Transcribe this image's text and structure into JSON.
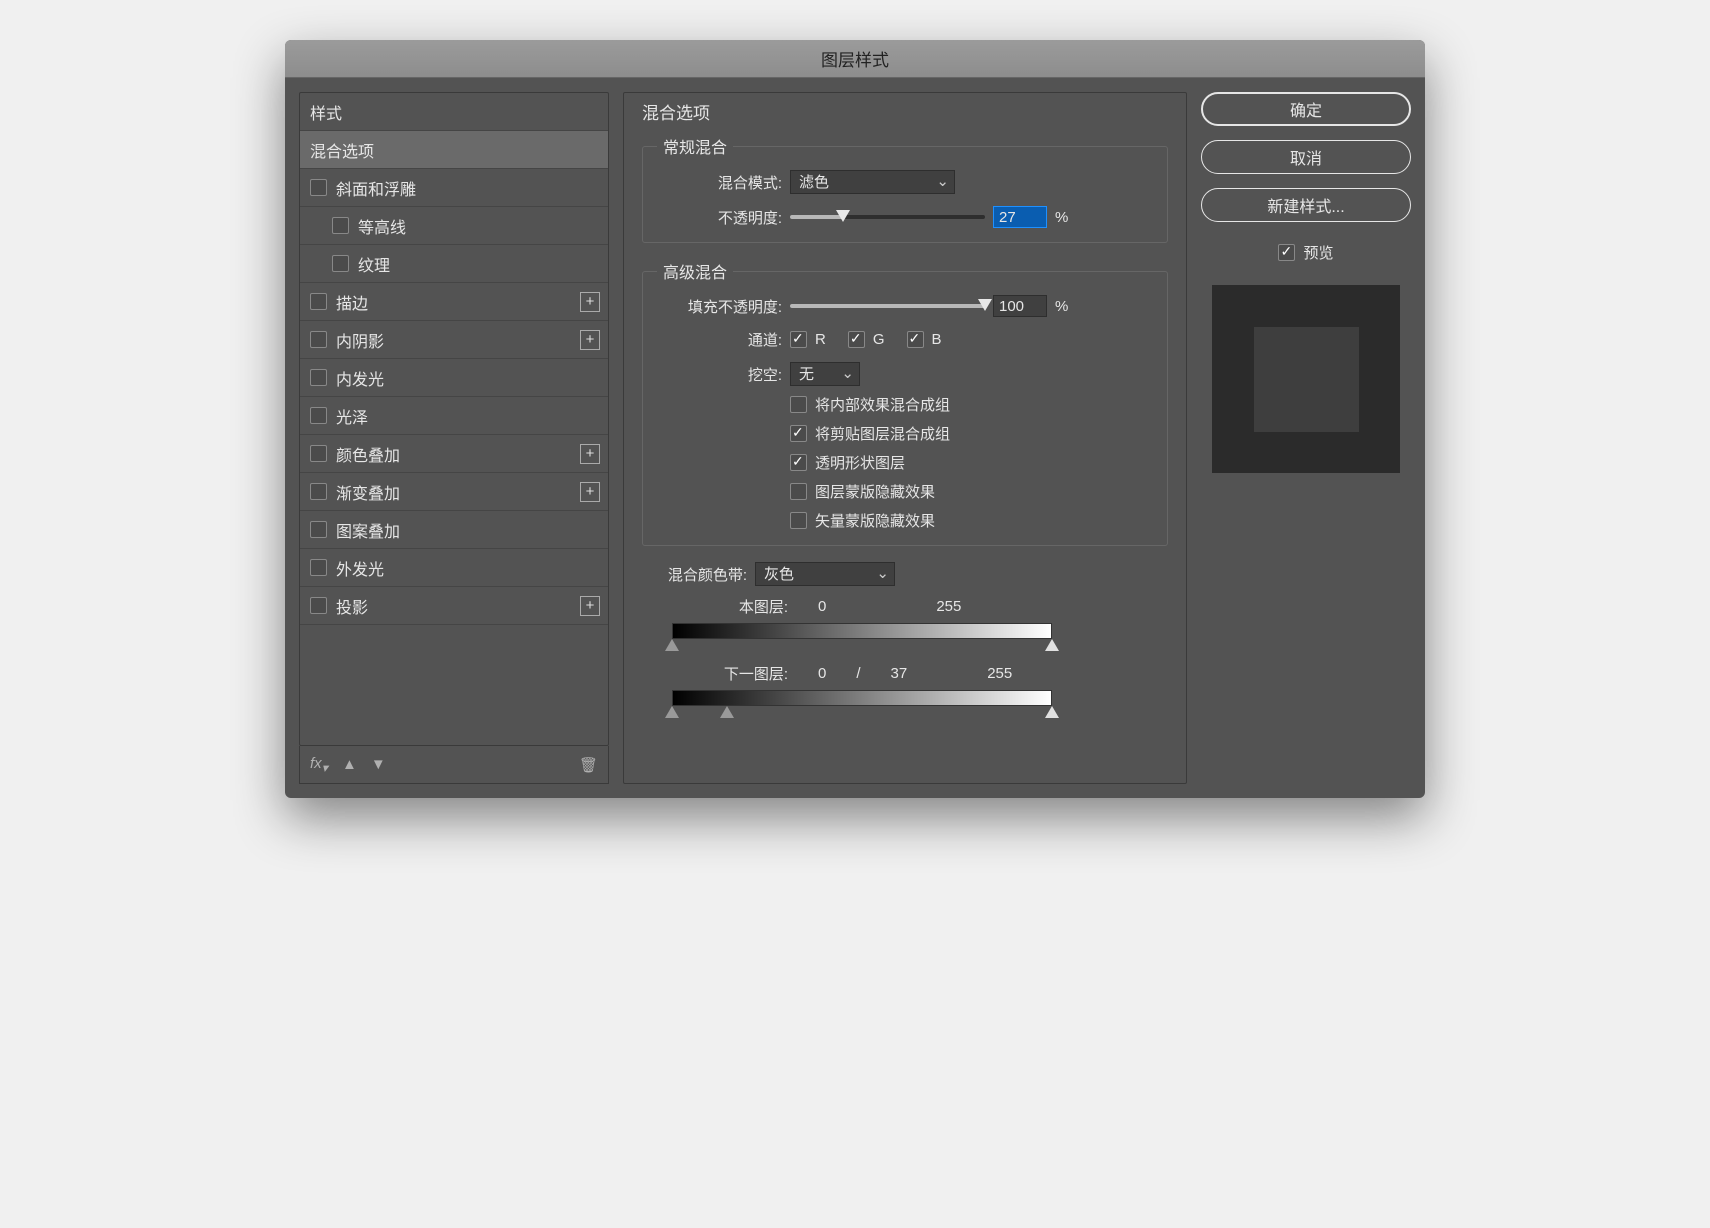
{
  "title": "图层样式",
  "sidebar": {
    "header": "样式",
    "items": [
      {
        "label": "混合选项",
        "selected": true
      },
      {
        "label": "斜面和浮雕",
        "check": false
      },
      {
        "label": "等高线",
        "check": false,
        "sub": true
      },
      {
        "label": "纹理",
        "check": false,
        "sub": true
      },
      {
        "label": "描边",
        "check": false,
        "plus": true
      },
      {
        "label": "内阴影",
        "check": false,
        "plus": true
      },
      {
        "label": "内发光",
        "check": false
      },
      {
        "label": "光泽",
        "check": false
      },
      {
        "label": "颜色叠加",
        "check": false,
        "plus": true
      },
      {
        "label": "渐变叠加",
        "check": false,
        "plus": true
      },
      {
        "label": "图案叠加",
        "check": false
      },
      {
        "label": "外发光",
        "check": false
      },
      {
        "label": "投影",
        "check": false,
        "plus": true
      }
    ]
  },
  "center": {
    "title": "混合选项",
    "normal": {
      "legend": "常规混合",
      "mode_label": "混合模式:",
      "mode_value": "滤色",
      "opacity_label": "不透明度:",
      "opacity_value": "27",
      "opacity_unit": "%"
    },
    "advanced": {
      "legend": "高级混合",
      "fill_label": "填充不透明度:",
      "fill_value": "100",
      "fill_unit": "%",
      "channels_label": "通道:",
      "ch_r": "R",
      "ch_g": "G",
      "ch_b": "B",
      "knockout_label": "挖空:",
      "knockout_value": "无",
      "opts": [
        {
          "label": "将内部效果混合成组",
          "checked": false
        },
        {
          "label": "将剪贴图层混合成组",
          "checked": true
        },
        {
          "label": "透明形状图层",
          "checked": true
        },
        {
          "label": "图层蒙版隐藏效果",
          "checked": false
        },
        {
          "label": "矢量蒙版隐藏效果",
          "checked": false
        }
      ]
    },
    "blendif": {
      "label": "混合颜色带:",
      "value": "灰色",
      "this_label": "本图层:",
      "this_low": "0",
      "this_high": "255",
      "under_label": "下一图层:",
      "under_low": "0",
      "under_sep": "/",
      "under_low2": "37",
      "under_high": "255"
    }
  },
  "right": {
    "ok": "确定",
    "cancel": "取消",
    "newstyle": "新建样式...",
    "preview": "预览"
  }
}
